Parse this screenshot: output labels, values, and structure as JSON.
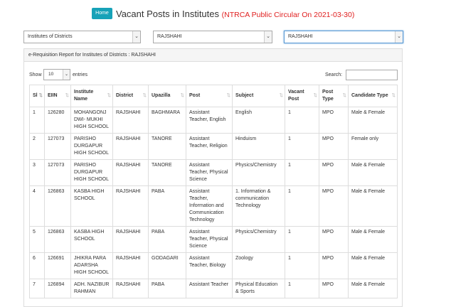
{
  "header": {
    "home_label": "Home",
    "title": "Vacant Posts in Institutes",
    "subtitle": "(NTRCA Public Circular On 2021-03-30)"
  },
  "filters": {
    "institute_type": "Institutes of Districts",
    "district_1": "RAJSHAHI",
    "district_2": "RAJSHAHI"
  },
  "report": {
    "heading": "e-Requisition Report for Institutes of Districts : RAJSHAHI",
    "show_label": "Show",
    "entries_value": "10",
    "entries_label": "entries",
    "search_label": "Search:",
    "search_value": ""
  },
  "table": {
    "columns": [
      "Sl",
      "EIIN",
      "Institute Name",
      "District",
      "Upazilla",
      "Post",
      "Subject",
      "Vacant Post",
      "Post Type",
      "Candidate Type"
    ],
    "rows": [
      {
        "sl": "1",
        "eiin": "126280",
        "name": "MOHANGONJ DWI- MUKHI HIGH SCHOOL",
        "district": "RAJSHAHI",
        "upazilla": "BAGHMARA",
        "post": "Assistant Teacher, English",
        "subject": "English",
        "vacant": "1",
        "post_type": "MPO",
        "candidate": "Male & Female"
      },
      {
        "sl": "2",
        "eiin": "127073",
        "name": "PARISHO DURGAPUR HIGH SCHOOL",
        "district": "RAJSHAHI",
        "upazilla": "TANORE",
        "post": "Assistant Teacher, Religion",
        "subject": "Hinduism",
        "vacant": "1",
        "post_type": "MPO",
        "candidate": "Female only"
      },
      {
        "sl": "3",
        "eiin": "127073",
        "name": "PARISHO DURGAPUR HIGH SCHOOL",
        "district": "RAJSHAHI",
        "upazilla": "TANORE",
        "post": "Assistant Teacher, Physical Science",
        "subject": "Physics/Chemistry",
        "vacant": "1",
        "post_type": "MPO",
        "candidate": "Male & Female"
      },
      {
        "sl": "4",
        "eiin": "126863",
        "name": "KASBA HIGH SCHOOL",
        "district": "RAJSHAHI",
        "upazilla": "PABA",
        "post": "Assistant Teacher, Information and Communication Technology",
        "subject": "1. Information & communication Technology",
        "vacant": "1",
        "post_type": "MPO",
        "candidate": "Male & Female"
      },
      {
        "sl": "5",
        "eiin": "126863",
        "name": "KASBA HIGH SCHOOL",
        "district": "RAJSHAHI",
        "upazilla": "PABA",
        "post": "Assistant Teacher, Physical Science",
        "subject": "Physics/Chemistry",
        "vacant": "1",
        "post_type": "MPO",
        "candidate": "Male & Female"
      },
      {
        "sl": "6",
        "eiin": "126691",
        "name": "JHIKRA PARA ADARSHA HIGH SCHOOL",
        "district": "RAJSHAHI",
        "upazilla": "GODAGARI",
        "post": "Assistant Teacher, Biology",
        "subject": "Zoology",
        "vacant": "1",
        "post_type": "MPO",
        "candidate": "Male & Female"
      },
      {
        "sl": "7",
        "eiin": "126894",
        "name": "ADH. NAZIBUR RAHMAN",
        "district": "RAJSHAHI",
        "upazilla": "PABA",
        "post": "Assistant Teacher",
        "subject": "Physical Education & Sports",
        "vacant": "1",
        "post_type": "MPO",
        "candidate": "Male & Female"
      }
    ]
  },
  "colors": {
    "home_button": "#17a2b8",
    "subtitle": "#e02020"
  }
}
